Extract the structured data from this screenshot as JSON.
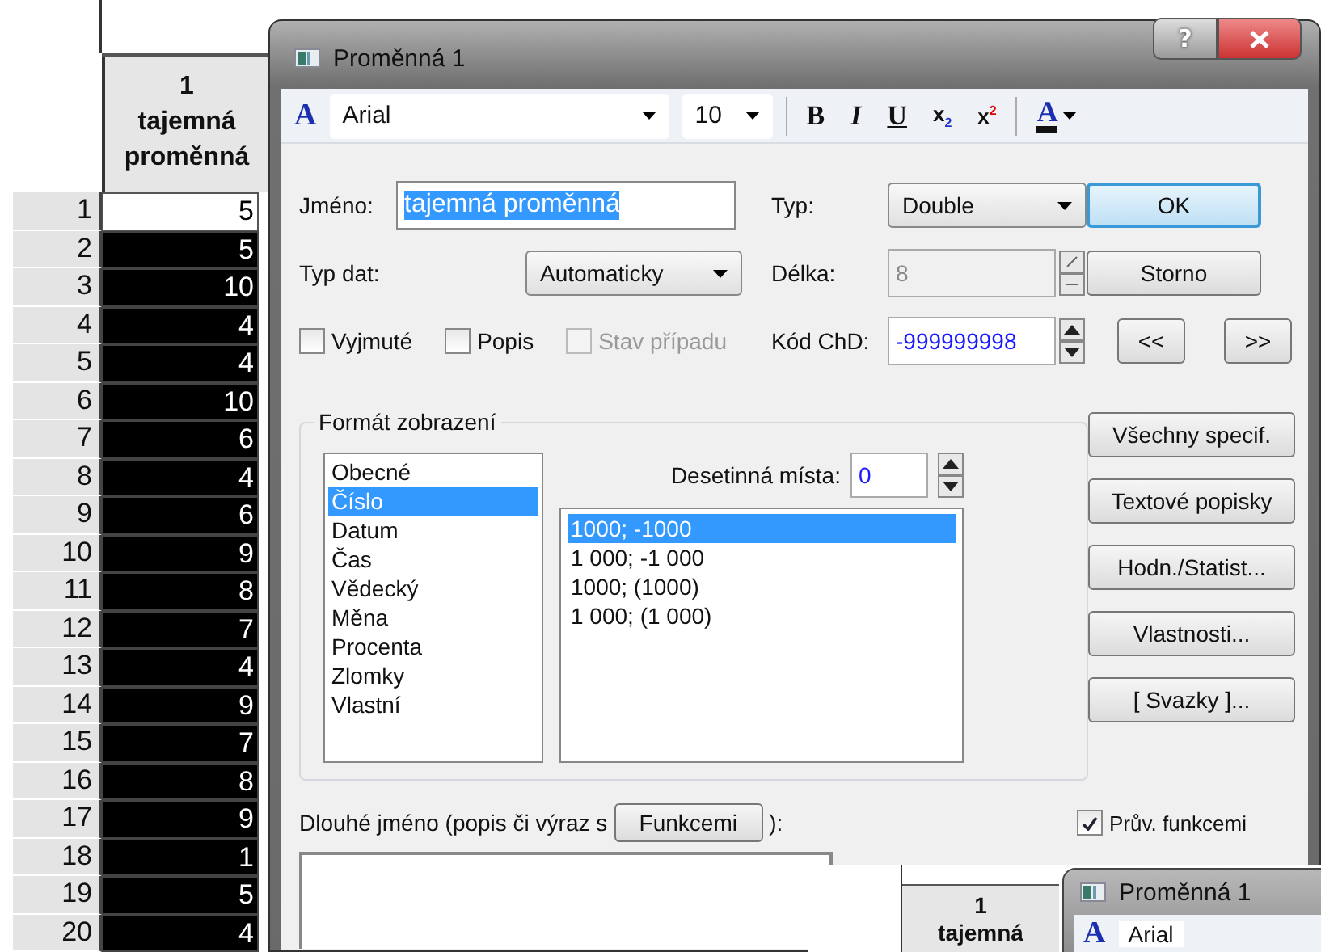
{
  "sheet": {
    "column_header": {
      "number": "1",
      "name_lines": [
        "tajemná",
        "proměnná"
      ]
    },
    "rows": [
      {
        "number": "1",
        "value": "5",
        "selected": false
      },
      {
        "number": "2",
        "value": "5",
        "selected": true
      },
      {
        "number": "3",
        "value": "10",
        "selected": true
      },
      {
        "number": "4",
        "value": "4",
        "selected": true
      },
      {
        "number": "5",
        "value": "4",
        "selected": true
      },
      {
        "number": "6",
        "value": "10",
        "selected": true
      },
      {
        "number": "7",
        "value": "6",
        "selected": true
      },
      {
        "number": "8",
        "value": "4",
        "selected": true
      },
      {
        "number": "9",
        "value": "6",
        "selected": true
      },
      {
        "number": "10",
        "value": "9",
        "selected": true
      },
      {
        "number": "11",
        "value": "8",
        "selected": true
      },
      {
        "number": "12",
        "value": "7",
        "selected": true
      },
      {
        "number": "13",
        "value": "4",
        "selected": true
      },
      {
        "number": "14",
        "value": "9",
        "selected": true
      },
      {
        "number": "15",
        "value": "7",
        "selected": true
      },
      {
        "number": "16",
        "value": "8",
        "selected": true
      },
      {
        "number": "17",
        "value": "9",
        "selected": true
      },
      {
        "number": "18",
        "value": "1",
        "selected": true
      },
      {
        "number": "19",
        "value": "5",
        "selected": true
      },
      {
        "number": "20",
        "value": "4",
        "selected": true
      }
    ]
  },
  "dialog": {
    "title": "Proměnná 1",
    "help": "?",
    "toolbar": {
      "font_icon": "A",
      "font": "Arial",
      "size": "10",
      "buttons": [
        {
          "kind": "bold",
          "label": "B"
        },
        {
          "kind": "italic",
          "label": "I"
        },
        {
          "kind": "underline",
          "label": "U"
        },
        {
          "kind": "subscript",
          "label": "x$_{2}$"
        },
        {
          "kind": "superscript",
          "label": "x$^{2}$"
        }
      ],
      "color_button": "A"
    },
    "name": {
      "label": "Jméno:",
      "value": "tajemná proměnná",
      "text_selected": true
    },
    "type": {
      "label": "Typ:",
      "value": "Double"
    },
    "data_type": {
      "label": "Typ dat:",
      "value": "Automaticky"
    },
    "length": {
      "label": "Délka:",
      "value": "8",
      "disabled": true
    },
    "missing_code": {
      "label": "Kód ChD:",
      "value": "-999999998",
      "disabled": false
    },
    "checkboxes": [
      {
        "label": "Vyjmuté",
        "checked": false,
        "disabled": false
      },
      {
        "label": "Popis",
        "checked": false,
        "disabled": false
      },
      {
        "label": "Stav případu",
        "checked": false,
        "disabled": true
      }
    ],
    "buttons": [
      {
        "label": "OK",
        "default": true
      },
      {
        "label": "Storno",
        "default": false
      }
    ],
    "nav_buttons": [
      "<<",
      ">>"
    ],
    "format": {
      "title": "Formát zobrazení",
      "categories": [
        {
          "label": "Obecné",
          "selected": false
        },
        {
          "label": "Číslo",
          "selected": true
        },
        {
          "label": "Datum",
          "selected": false
        },
        {
          "label": "Čas",
          "selected": false
        },
        {
          "label": "Vědecký",
          "selected": false
        },
        {
          "label": "Měna",
          "selected": false
        },
        {
          "label": "Procenta",
          "selected": false
        },
        {
          "label": "Zlomky",
          "selected": false
        },
        {
          "label": "Vlastní",
          "selected": false
        }
      ],
      "decimals": {
        "label": "Desetinná místa:",
        "value": "0"
      },
      "formats": [
        {
          "label": "1000; -1000",
          "selected": true
        },
        {
          "label": "1 000; -1 000",
          "selected": false
        },
        {
          "label": "1000; (1000)",
          "selected": false
        },
        {
          "label": "1 000; (1 000)",
          "selected": false
        }
      ]
    },
    "side_buttons": [
      "Všechny specif.",
      "Textové popisky",
      "Hodn./Statist...",
      "Vlastnosti...",
      "[ Svazky ]..."
    ],
    "long_name": {
      "label_before": "Dlouhé jméno (popis či výraz s",
      "button": "Funkcemi",
      "label_after": "):"
    },
    "wizard": {
      "label": "Prův. funkcemi",
      "checked": true
    }
  },
  "inset": {
    "column_number": "1",
    "column_name": "tajemná",
    "dialog_title": "Proměnná 1",
    "font_icon": "A",
    "font": "Arial"
  }
}
